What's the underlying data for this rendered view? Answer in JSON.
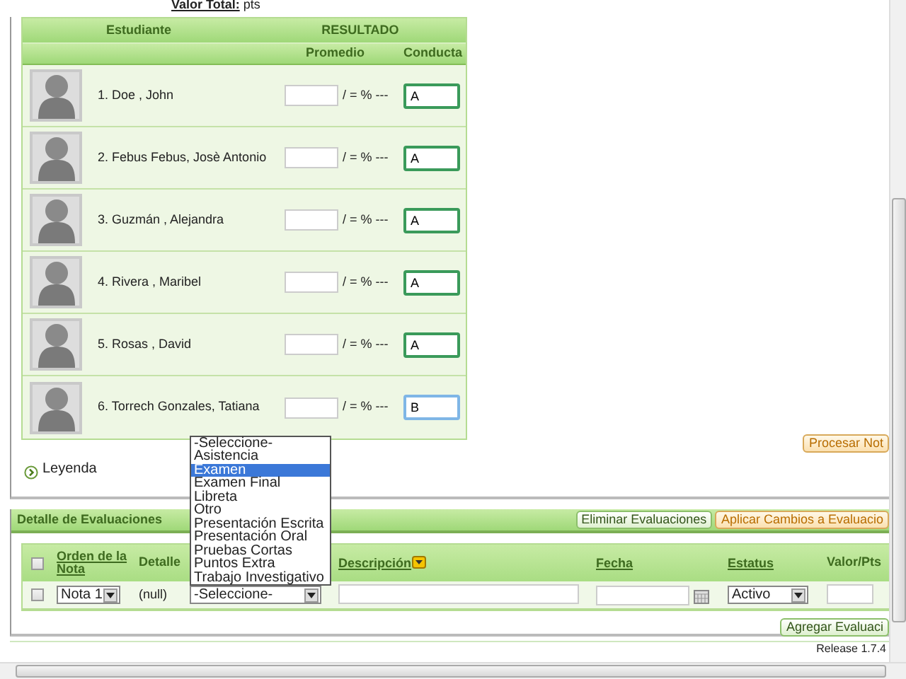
{
  "summary": {
    "label": "Valor Total:",
    "unit": "pts"
  },
  "students": {
    "columns": [
      "Estudiante",
      "RESULTADO"
    ],
    "subcolumns": [
      "Promedio",
      "Conducta"
    ],
    "rows": [
      {
        "name": "1. Doe , John",
        "average": "",
        "formula": "/ = % ---",
        "conduct": "A",
        "focused": false
      },
      {
        "name": "2. Febus Febus, Josè Antonio",
        "average": "",
        "formula": "/ = % ---",
        "conduct": "A",
        "focused": false
      },
      {
        "name": "3. Guzmán , Alejandra",
        "average": "",
        "formula": "/ = % ---",
        "conduct": "A",
        "focused": false
      },
      {
        "name": "4. Rivera , Maribel",
        "average": "",
        "formula": "/ = % ---",
        "conduct": "A",
        "focused": false
      },
      {
        "name": "5. Rosas , David",
        "average": "",
        "formula": "/ = % ---",
        "conduct": "A",
        "focused": false
      },
      {
        "name": "6. Torrech Gonzales, Tatiana",
        "average": "",
        "formula": "/ = % ---",
        "conduct": "B",
        "focused": true
      }
    ]
  },
  "legend": "Leyenda",
  "process_button": "Procesar Not",
  "details": {
    "title": "Detalle de Evaluaciones",
    "buttons": [
      {
        "label": "Eliminar Evaluaciones",
        "kind": "plain"
      },
      {
        "label": "Aplicar Cambios a Evaluacio",
        "kind": "accent"
      }
    ],
    "columns": [
      {
        "kind": "checkbox",
        "checked": false
      },
      {
        "kind": "link",
        "label": "Orden de la Nota"
      },
      {
        "kind": "text",
        "label": "Detalle"
      },
      {
        "kind": "blank"
      },
      {
        "kind": "sort",
        "label": "Descripción"
      },
      {
        "kind": "link",
        "label": "Fecha"
      },
      {
        "kind": "link",
        "label": "Estatus"
      },
      {
        "kind": "text",
        "label": "Valor/Pts"
      }
    ],
    "row": {
      "checked": false,
      "order": "Nota 1",
      "detail": "(null)",
      "type": "-Seleccione-",
      "status": "Activo"
    },
    "type_options": [
      {
        "label": "-Seleccione-",
        "selected": false
      },
      {
        "label": "Asistencia",
        "selected": false
      },
      {
        "label": "Examen",
        "selected": true
      },
      {
        "label": "Examen Final",
        "selected": false
      },
      {
        "label": "Libreta",
        "selected": false
      },
      {
        "label": "Otro",
        "selected": false
      },
      {
        "label": "Presentación Escrita",
        "selected": false
      },
      {
        "label": "Presentación Oral",
        "selected": false
      },
      {
        "label": "Pruebas Cortas",
        "selected": false
      },
      {
        "label": "Puntos Extra",
        "selected": false
      },
      {
        "label": "Trabajo Investigativo",
        "selected": false
      }
    ],
    "add_button": "Agregar Evaluaci"
  },
  "footer": "Release 1.7.4"
}
